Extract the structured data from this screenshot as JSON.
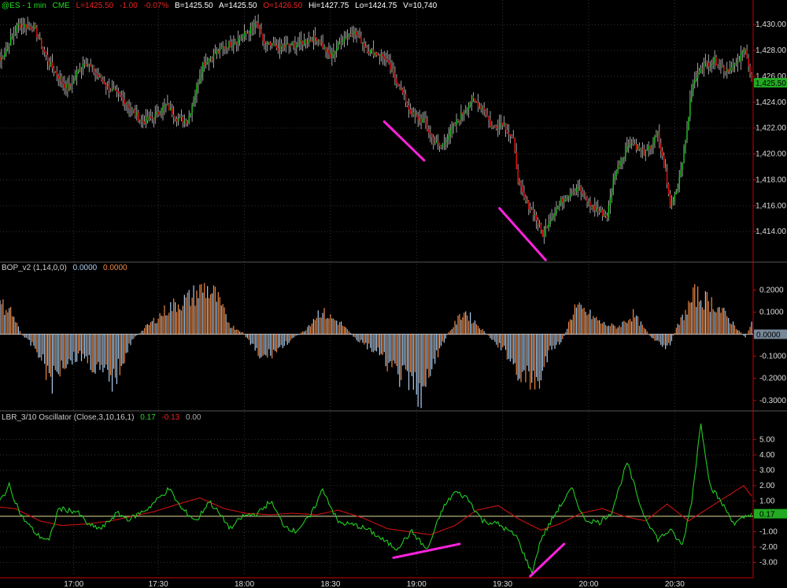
{
  "header": {
    "symbol": "@ES - 1 min",
    "exchange": "CME",
    "last": "L=1425.50",
    "change": "-1.00",
    "change_pct": "-0.07%",
    "bid": "B=1425.50",
    "ask": "A=1425.50",
    "open": "O=1426.50",
    "high": "Hi=1427.75",
    "low": "Lo=1424.75",
    "volume": "V=10,740"
  },
  "colors": {
    "background": "#000000",
    "up_candle": "#22cc22",
    "down_candle": "#ee1111",
    "wick": "#cccccc",
    "grid": "#333333",
    "axis_red": "#cc0000",
    "bop_pos": "#aaccee",
    "bop_neg": "#ee8844",
    "trendline": "#ff22dd",
    "osc_fast": "#22cc22",
    "osc_slow": "#cc1111",
    "osc_zero": "#dddd99"
  },
  "chart_data": [
    {
      "type": "candlestick",
      "title": "@ES - 1 min",
      "last_price_label": "1,425.50",
      "y_ticks": [
        "1,414.00",
        "1,416.00",
        "1,418.00",
        "1,420.00",
        "1,422.00",
        "1,424.00",
        "1,426.00",
        "1,428.00",
        "1,430.00"
      ],
      "ylim": [
        1411.7,
        1431.9
      ],
      "grid": true,
      "close_path_key_points": [
        [
          0,
          1427.2
        ],
        [
          12,
          1430.0
        ],
        [
          22,
          1429.8
        ],
        [
          32,
          1427.0
        ],
        [
          44,
          1425.0
        ],
        [
          55,
          1427.2
        ],
        [
          64,
          1426.0
        ],
        [
          72,
          1425.0
        ],
        [
          82,
          1424.0
        ],
        [
          92,
          1422.5
        ],
        [
          100,
          1422.8
        ],
        [
          108,
          1423.8
        ],
        [
          115,
          1422.8
        ],
        [
          122,
          1422.5
        ],
        [
          132,
          1427.0
        ],
        [
          145,
          1428.2
        ],
        [
          157,
          1429.0
        ],
        [
          167,
          1430.0
        ],
        [
          172,
          1428.5
        ],
        [
          180,
          1428.2
        ],
        [
          193,
          1428.5
        ],
        [
          206,
          1429.0
        ],
        [
          215,
          1427.5
        ],
        [
          222,
          1428.8
        ],
        [
          230,
          1429.5
        ],
        [
          240,
          1428.0
        ],
        [
          250,
          1427.5
        ],
        [
          260,
          1425.2
        ],
        [
          268,
          1423.0
        ],
        [
          276,
          1422.5
        ],
        [
          282,
          1421.0
        ],
        [
          287,
          1420.5
        ],
        [
          292,
          1421.5
        ],
        [
          300,
          1423.0
        ],
        [
          307,
          1424.2
        ],
        [
          315,
          1423.5
        ],
        [
          320,
          1422.0
        ],
        [
          327,
          1422.5
        ],
        [
          334,
          1421.0
        ],
        [
          337,
          1418.0
        ],
        [
          341,
          1416.5
        ],
        [
          347,
          1415.5
        ],
        [
          353,
          1413.8
        ],
        [
          358,
          1415.0
        ],
        [
          366,
          1416.5
        ],
        [
          376,
          1417.5
        ],
        [
          384,
          1416.0
        ],
        [
          395,
          1415.2
        ],
        [
          400,
          1418.5
        ],
        [
          410,
          1421.0
        ],
        [
          420,
          1420.0
        ],
        [
          428,
          1421.5
        ],
        [
          433,
          1418.5
        ],
        [
          436,
          1416.0
        ],
        [
          441,
          1417.5
        ],
        [
          446,
          1421.0
        ],
        [
          450,
          1425.0
        ],
        [
          456,
          1426.8
        ],
        [
          465,
          1427.2
        ],
        [
          472,
          1426.5
        ],
        [
          480,
          1427.0
        ],
        [
          485,
          1428.3
        ],
        [
          489,
          1425.5
        ]
      ],
      "annotations": [
        {
          "type": "trendline",
          "from": [
            250,
            1422.5
          ],
          "to": [
            276,
            1419.5
          ]
        },
        {
          "type": "trendline",
          "from": [
            325,
            1415.8
          ],
          "to": [
            355,
            1411.8
          ]
        }
      ]
    },
    {
      "type": "bar",
      "title": "BOP_v2 (1,14,0,0)",
      "legend": [
        "0.0000",
        "0.0000"
      ],
      "last_value_label": "0.0000",
      "y_ticks": [
        "0.2000",
        "0.1000",
        "0.0000",
        "-0.1000",
        "-0.2000",
        "-0.3000"
      ],
      "ylim": [
        -0.34,
        0.28
      ],
      "bop_key_points": [
        [
          0,
          0.16
        ],
        [
          6,
          0.15
        ],
        [
          14,
          0.0
        ],
        [
          24,
          -0.09
        ],
        [
          34,
          -0.27
        ],
        [
          40,
          -0.17
        ],
        [
          48,
          -0.13
        ],
        [
          55,
          -0.12
        ],
        [
          64,
          -0.21
        ],
        [
          74,
          -0.26
        ],
        [
          86,
          -0.03
        ],
        [
          95,
          0.04
        ],
        [
          110,
          0.15
        ],
        [
          123,
          0.2
        ],
        [
          133,
          0.26
        ],
        [
          140,
          0.22
        ],
        [
          150,
          0.05
        ],
        [
          158,
          0.01
        ],
        [
          170,
          -0.14
        ],
        [
          180,
          -0.09
        ],
        [
          188,
          -0.04
        ],
        [
          198,
          0.02
        ],
        [
          208,
          0.13
        ],
        [
          222,
          0.06
        ],
        [
          232,
          -0.03
        ],
        [
          245,
          -0.1
        ],
        [
          258,
          -0.22
        ],
        [
          270,
          -0.3
        ],
        [
          276,
          -0.34
        ],
        [
          284,
          -0.12
        ],
        [
          292,
          0.01
        ],
        [
          302,
          0.13
        ],
        [
          310,
          0.06
        ],
        [
          320,
          -0.03
        ],
        [
          330,
          -0.11
        ],
        [
          340,
          -0.25
        ],
        [
          350,
          -0.28
        ],
        [
          358,
          -0.09
        ],
        [
          366,
          -0.03
        ],
        [
          374,
          0.15
        ],
        [
          382,
          0.12
        ],
        [
          392,
          0.06
        ],
        [
          402,
          0.04
        ],
        [
          412,
          0.11
        ],
        [
          425,
          -0.03
        ],
        [
          434,
          -0.09
        ],
        [
          440,
          0.03
        ],
        [
          452,
          0.22
        ],
        [
          465,
          0.17
        ],
        [
          475,
          0.08
        ],
        [
          485,
          -0.02
        ],
        [
          489,
          0.06
        ]
      ]
    },
    {
      "type": "line",
      "title": "LBR_3/10 Oscillator (Close,3,10,16,1)",
      "legend": [
        "0.17",
        "-0.13",
        "0.00"
      ],
      "last_value_label": "0.17",
      "y_ticks": [
        "5.00",
        "4.00",
        "3.00",
        "2.00",
        "1.00",
        "-1.00",
        "-2.00",
        "-3.00"
      ],
      "ylim": [
        -3.9,
        6.2
      ],
      "x_ticks": [
        {
          "label": "17:00",
          "bar": 48
        },
        {
          "label": "17:30",
          "bar": 103
        },
        {
          "label": "18:00",
          "bar": 159
        },
        {
          "label": "18:30",
          "bar": 215
        },
        {
          "label": "19:00",
          "bar": 271
        },
        {
          "label": "19:30",
          "bar": 327
        },
        {
          "label": "20:00",
          "bar": 383
        },
        {
          "label": "20:30",
          "bar": 439
        }
      ],
      "fast_key_points": [
        [
          0,
          1.0
        ],
        [
          6,
          2.0
        ],
        [
          14,
          0.0
        ],
        [
          24,
          -1.2
        ],
        [
          32,
          -1.6
        ],
        [
          38,
          0.5
        ],
        [
          50,
          0.3
        ],
        [
          58,
          -0.6
        ],
        [
          66,
          -0.8
        ],
        [
          76,
          0.2
        ],
        [
          84,
          -0.2
        ],
        [
          96,
          0.5
        ],
        [
          110,
          1.8
        ],
        [
          118,
          0.5
        ],
        [
          128,
          -0.3
        ],
        [
          136,
          1.0
        ],
        [
          144,
          0.0
        ],
        [
          150,
          -0.8
        ],
        [
          158,
          0.0
        ],
        [
          168,
          0.2
        ],
        [
          176,
          1.0
        ],
        [
          184,
          -0.5
        ],
        [
          192,
          -1.0
        ],
        [
          202,
          0.0
        ],
        [
          210,
          1.8
        ],
        [
          220,
          -0.4
        ],
        [
          232,
          -0.6
        ],
        [
          240,
          -0.9
        ],
        [
          250,
          -1.6
        ],
        [
          258,
          -2.1
        ],
        [
          268,
          -1.0
        ],
        [
          278,
          -2.2
        ],
        [
          288,
          0.5
        ],
        [
          296,
          1.6
        ],
        [
          304,
          1.2
        ],
        [
          314,
          -0.3
        ],
        [
          324,
          -0.5
        ],
        [
          336,
          -1.3
        ],
        [
          346,
          -3.7
        ],
        [
          352,
          -1.5
        ],
        [
          362,
          0.3
        ],
        [
          372,
          1.8
        ],
        [
          380,
          -0.2
        ],
        [
          390,
          -0.4
        ],
        [
          398,
          0.3
        ],
        [
          408,
          3.5
        ],
        [
          418,
          0.3
        ],
        [
          428,
          -1.5
        ],
        [
          436,
          -0.9
        ],
        [
          444,
          -1.9
        ],
        [
          450,
          1.0
        ],
        [
          456,
          6.1
        ],
        [
          462,
          2.0
        ],
        [
          470,
          0.8
        ],
        [
          478,
          -0.5
        ],
        [
          484,
          -0.1
        ],
        [
          489,
          0.2
        ]
      ],
      "slow_key_points": [
        [
          0,
          0.6
        ],
        [
          10,
          0.5
        ],
        [
          26,
          -0.3
        ],
        [
          40,
          -0.6
        ],
        [
          56,
          -0.5
        ],
        [
          72,
          -0.3
        ],
        [
          86,
          0.0
        ],
        [
          100,
          0.3
        ],
        [
          116,
          0.8
        ],
        [
          130,
          1.2
        ],
        [
          146,
          0.5
        ],
        [
          160,
          0.2
        ],
        [
          176,
          0.1
        ],
        [
          190,
          0.2
        ],
        [
          206,
          0.1
        ],
        [
          220,
          0.4
        ],
        [
          236,
          -0.1
        ],
        [
          252,
          -0.8
        ],
        [
          266,
          -1.0
        ],
        [
          280,
          -1.2
        ],
        [
          296,
          -0.6
        ],
        [
          310,
          0.4
        ],
        [
          324,
          0.7
        ],
        [
          338,
          -0.2
        ],
        [
          352,
          -0.9
        ],
        [
          364,
          -0.5
        ],
        [
          378,
          0.2
        ],
        [
          392,
          0.5
        ],
        [
          406,
          0.0
        ],
        [
          420,
          -0.3
        ],
        [
          434,
          0.8
        ],
        [
          448,
          -0.3
        ],
        [
          462,
          0.6
        ],
        [
          476,
          1.5
        ],
        [
          484,
          2.0
        ],
        [
          489,
          1.3
        ]
      ],
      "annotations": [
        {
          "type": "trendline",
          "from": [
            256,
            -2.7
          ],
          "to": [
            299,
            -1.8
          ]
        },
        {
          "type": "trendline",
          "from": [
            345,
            -3.9
          ],
          "to": [
            367,
            -1.8
          ]
        }
      ]
    }
  ]
}
